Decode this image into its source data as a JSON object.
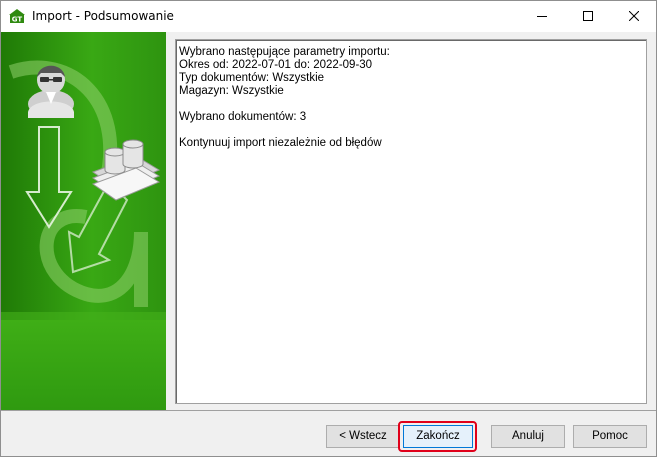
{
  "window": {
    "title": "Import - Podsumowanie"
  },
  "summary": {
    "lines": [
      "Wybrano następujące parametry importu:",
      "Okres od: 2022-07-01 do: 2022-09-30",
      "Typ dokumentów: Wszystkie",
      "Magazyn: Wszystkie",
      "",
      "Wybrano dokumentów: 3",
      "",
      "Kontynuuj import niezależnie od błędów"
    ]
  },
  "buttons": {
    "back_label": "< Wstecz",
    "finish_label": "Zakończ",
    "cancel_label": "Anuluj",
    "help_label": "Pomoc"
  },
  "colors": {
    "panel_green": "#2f9a10",
    "panel_green_dark": "#1f7a06",
    "focus_ring": "#e0001a"
  },
  "icons": {
    "app": "gt-app-icon",
    "minimize": "minimize-icon",
    "maximize": "maximize-icon",
    "close": "close-icon",
    "user": "user-icon",
    "database": "database-stack-icon",
    "arrows": "import-arrows-icon"
  }
}
